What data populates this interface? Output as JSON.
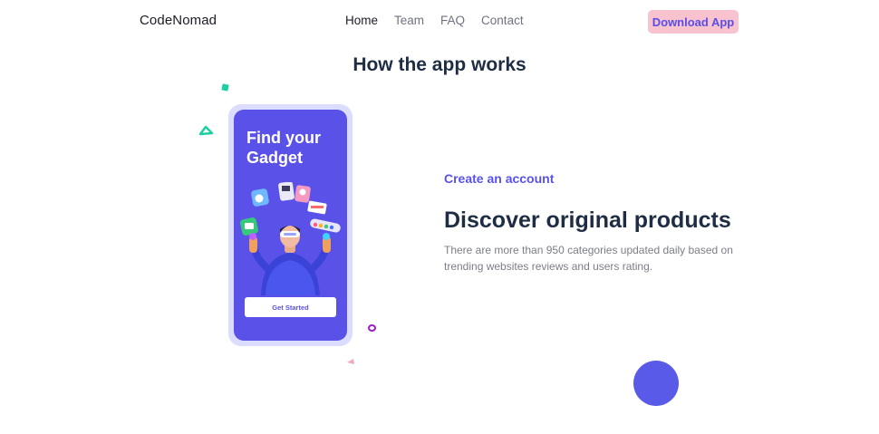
{
  "nav": {
    "brand": "CodeNomad",
    "links": [
      {
        "label": "Home",
        "active": true
      },
      {
        "label": "Team",
        "active": false
      },
      {
        "label": "FAQ",
        "active": false
      },
      {
        "label": "Contact",
        "active": false
      }
    ],
    "download_label": "Download App"
  },
  "section": {
    "title": "How the app works"
  },
  "phone": {
    "title": "Find your Gadget",
    "button_label": "Get Started"
  },
  "step": {
    "label": "Create an account",
    "heading": "Discover original products",
    "description": "There are more than 950 categories updated daily based on trending websites reviews and users rating."
  },
  "colors": {
    "accent": "#5a52e8",
    "download_bg": "#f8c3cf",
    "heading": "#1f2d44",
    "teal": "#1bcfa0",
    "purple_ring": "#9c1ec7"
  }
}
